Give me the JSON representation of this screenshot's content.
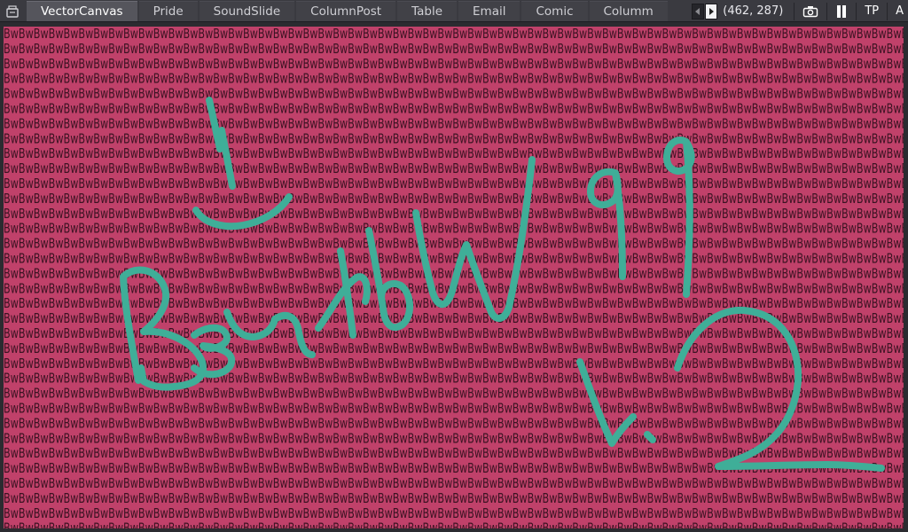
{
  "tabs": [
    {
      "label": "VectorCanvas",
      "active": true
    },
    {
      "label": "Pride",
      "active": false
    },
    {
      "label": "SoundSlide",
      "active": false
    },
    {
      "label": "ColumnPost",
      "active": false
    },
    {
      "label": "Table",
      "active": false
    },
    {
      "label": "Email",
      "active": false
    },
    {
      "label": "Comic",
      "active": false
    },
    {
      "label": "Columm",
      "active": false
    }
  ],
  "toolbar": {
    "coordinates": "(462, 287)",
    "tp_label": "TP",
    "a_label": "A"
  },
  "canvas": {
    "pattern_text": "BwBwBwBwBwBwBwBwBwBwBwBwBwBwBwBwBwBwBwBwBwBwBwBwBwBwBwBwBwBwBwBwBwBwBwBwBwBwBwBwBwBwBwBwBwBwBwBwBwBwBwBwBwBwBwBwBwBwBwBwBwBwBwBw",
    "background_color": "#c0416a",
    "pattern_color": "#3a1322",
    "stroke_color": "#3fae98"
  }
}
